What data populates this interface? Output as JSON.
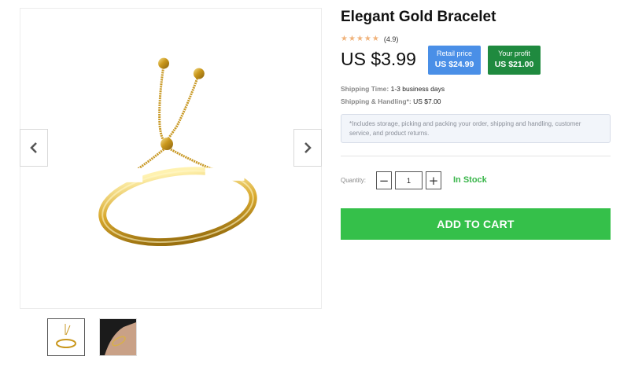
{
  "gallery": {
    "prev_icon": "chevron-left-icon",
    "next_icon": "chevron-right-icon",
    "thumbnails": [
      "bracelet-product-thumbnail",
      "bracelet-worn-on-wrist-thumbnail"
    ]
  },
  "product": {
    "title": "Elegant Gold Bracelet",
    "rating": {
      "stars": 5,
      "value": "(4.9)",
      "star_color": "#f0b27a"
    },
    "price": "US $3.99",
    "retail": {
      "label": "Retail price",
      "value": "US $24.99",
      "color": "#4a8fe7"
    },
    "profit": {
      "label": "Your profit",
      "value": "US $21.00",
      "color": "#1f8a3f"
    }
  },
  "shipping": {
    "time_label": "Shipping Time:",
    "time_value": "1-3 business days",
    "handling_label": "Shipping & Handling*:",
    "handling_value": "US $7.00",
    "note": "*Includes storage, picking and packing your order, shipping and handling, customer service, and product returns."
  },
  "purchase": {
    "quantity_label": "Quantity:",
    "quantity_value": "1",
    "minus": "−",
    "plus": "+",
    "stock_status": "In Stock",
    "stock_color": "#39b54a",
    "add_to_cart_label": "ADD TO CART",
    "add_to_cart_color": "#35c04a"
  }
}
